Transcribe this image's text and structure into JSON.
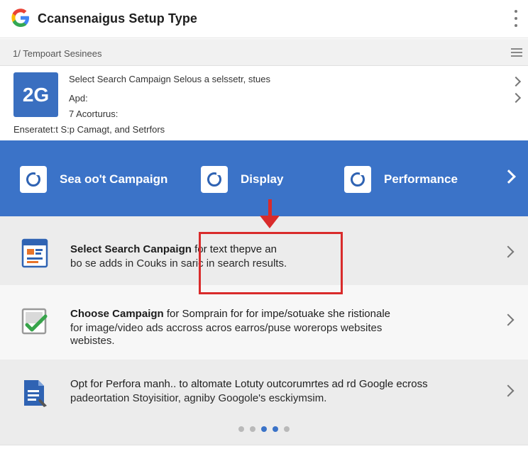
{
  "header": {
    "logo_letter": "G",
    "title": "Ccansenaigus Setup Type",
    "menu_icon": "kebab-menu-icon"
  },
  "steps": {
    "label": "1/ Tempoart Sesinees",
    "menu_icon": "hamburger-icon"
  },
  "account": {
    "logo_text": "2G",
    "line1": "Select Search Campaign Selous a selssetr, stues",
    "line2": "Apd:",
    "line3": "7 Acorturus:",
    "line4": "Enseratet:t S:p Camagt, and Setrfors"
  },
  "campaign_types": {
    "items": [
      {
        "label": "Sea oo't Campaign",
        "icon": "target-icon"
      },
      {
        "label": "Display",
        "icon": "target-icon"
      },
      {
        "label": "Performance",
        "icon": "target-icon"
      }
    ],
    "next_icon": "chevron-right-icon",
    "bar_color": "#3b73c8"
  },
  "rows": [
    {
      "title_bold": "Select Search Canpaign",
      "title_rest": " for text thepve an",
      "desc": [
        "bo se adds in Couks in saric in search results."
      ],
      "icon": "search-campaign-icon"
    },
    {
      "title_bold": "Choose Campaign",
      "title_rest": " for Somprain for for impe/sotuake she ristionale",
      "desc": [
        "for image/video ads accross acros earros/puse worerops websites",
        "webistes."
      ],
      "icon": "display-checkmark-icon"
    },
    {
      "title_bold": "",
      "title_rest": "Opt for Perfora manh.. to altomate Lotuty outcorumrtes ad rd Google ecross",
      "desc": [
        "padeortation Stoyisitior, agniby Googole's esckiymsim."
      ],
      "icon": "performance-document-icon"
    }
  ],
  "highlight_color": "#d92b2b",
  "pagination": {
    "count": 5,
    "active": 3
  }
}
